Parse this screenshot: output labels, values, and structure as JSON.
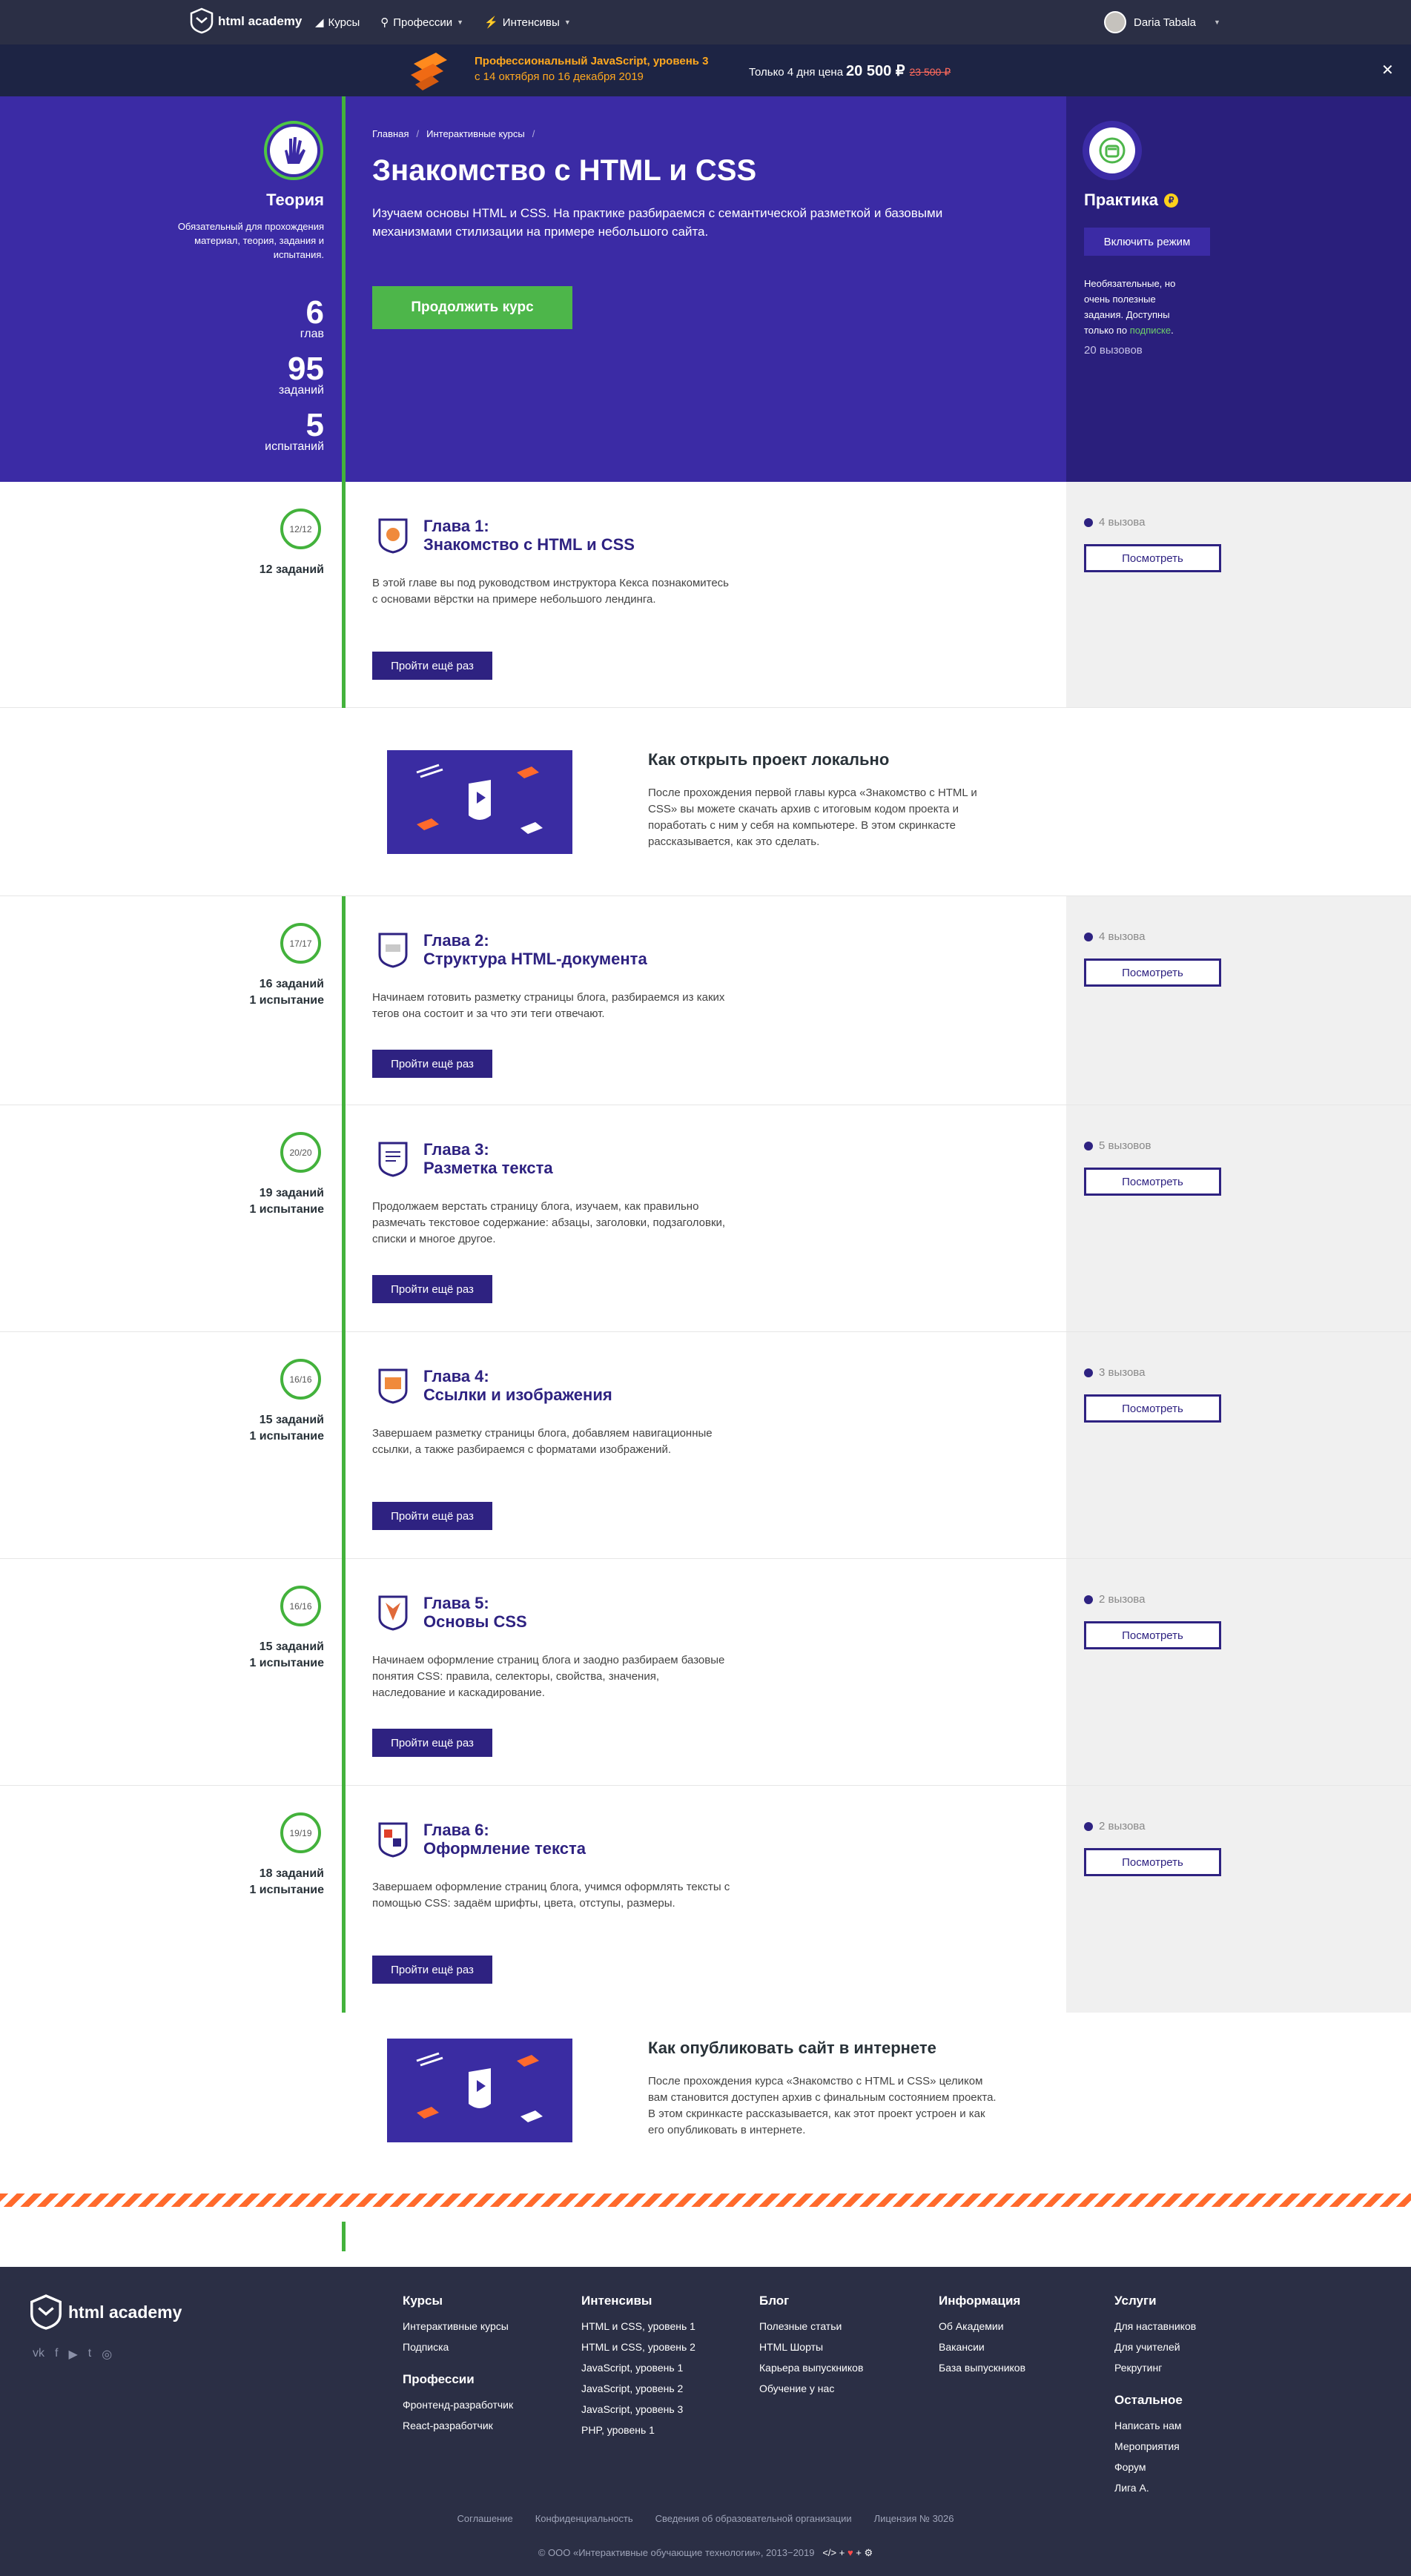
{
  "nav": {
    "logo": "html academy",
    "links": [
      "Курсы",
      "Профессии",
      "Интенсивы"
    ],
    "user": "Daria Tabala"
  },
  "banner": {
    "title": "Профессиональный JavaScript, уровень 3",
    "dates": "с 14 октября по 16 декабря 2019",
    "price_label": "Только 4 дня цена",
    "price": "20 500 ₽",
    "old_price": "23 500 ₽"
  },
  "hero": {
    "theory_title": "Теория",
    "theory_desc": "Обязательный для прохождения материал, теория, задания и испытания.",
    "stats": [
      {
        "n": "6",
        "l": "глав"
      },
      {
        "n": "95",
        "l": "заданий"
      },
      {
        "n": "5",
        "l": "испытаний"
      }
    ],
    "crumbs": [
      "Главная",
      "Интерактивные курсы"
    ],
    "title": "Знакомство с HTML и CSS",
    "lead": "Изучаем основы HTML и CSS. На практике разбираемся с семантической разметкой и базовыми механизмами стилизации на примере небольшого сайта.",
    "continue": "Продолжить курс",
    "practice_title": "Практика",
    "practice_coin": "₽",
    "practice_btn": "Включить режим",
    "practice_desc_1": "Необязательные, но очень полезные задания. Доступны только по",
    "practice_desc_link": "подписке",
    "practice_count": "20 вызовов"
  },
  "chapters": [
    {
      "badge": "12/12",
      "tasks": "12 заданий",
      "tests": "",
      "title1": "Глава 1:",
      "title2": "Знакомство с HTML и CSS",
      "desc": "В этой главе вы под руководством инструктора Кекса познакомитесь с основами вёрстки на примере небольшого лендинга.",
      "btn": "Пройти ещё раз",
      "challenges": "4 вызова",
      "view": "Посмотреть"
    },
    {
      "badge": "17/17",
      "tasks": "16 заданий",
      "tests": "1 испытание",
      "title1": "Глава 2:",
      "title2": "Структура HTML-документа",
      "desc": "Начинаем готовить разметку страницы блога, разбираемся из каких тегов она состоит и за что эти теги отвечают.",
      "btn": "Пройти ещё раз",
      "challenges": "4 вызова",
      "view": "Посмотреть"
    },
    {
      "badge": "20/20",
      "tasks": "19 заданий",
      "tests": "1 испытание",
      "title1": "Глава 3:",
      "title2": "Разметка текста",
      "desc": "Продолжаем верстать страницу блога, изучаем, как правильно размечать текстовое содержание: абзацы, заголовки, подзаголовки, списки и многое другое.",
      "btn": "Пройти ещё раз",
      "challenges": "5 вызовов",
      "view": "Посмотреть"
    },
    {
      "badge": "16/16",
      "tasks": "15 заданий",
      "tests": "1 испытание",
      "title1": "Глава 4:",
      "title2": "Ссылки и изображения",
      "desc": "Завершаем разметку страницы блога, добавляем навигационные ссылки, а также разбираемся с форматами изображений.",
      "btn": "Пройти ещё раз",
      "challenges": "3 вызова",
      "view": "Посмотреть"
    },
    {
      "badge": "16/16",
      "tasks": "15 заданий",
      "tests": "1 испытание",
      "title1": "Глава 5:",
      "title2": "Основы CSS",
      "desc": "Начинаем оформление страниц блога и заодно разбираем базовые понятия CSS: правила, селекторы, свойства, значения, наследование и каскадирование.",
      "btn": "Пройти ещё раз",
      "challenges": "2 вызова",
      "view": "Посмотреть"
    },
    {
      "badge": "19/19",
      "tasks": "18 заданий",
      "tests": "1 испытание",
      "title1": "Глава 6:",
      "title2": "Оформление текста",
      "desc": "Завершаем оформление страниц блога, учимся оформлять тексты с помощью CSS: задаём шрифты, цвета, отступы, размеры.",
      "btn": "Пройти ещё раз",
      "challenges": "2 вызова",
      "view": "Посмотреть"
    }
  ],
  "videos": [
    {
      "title": "Как открыть проект локально",
      "desc": "После прохождения первой главы курса «Знакомство с HTML и CSS» вы можете скачать архив с итоговым кодом проекта и поработать с ним у себя на компьютере. В этом скринкасте рассказывается, как это сделать."
    },
    {
      "title": "Как опубликовать сайт в интернете",
      "desc": "После прохождения курса «Знакомство с HTML и CSS» целиком вам становится доступен архив с финальным состоянием проекта. В этом скринкасте рассказывается, как этот проект устроен и как его опубликовать в интернете."
    }
  ],
  "footer": {
    "logo": "html academy",
    "cols": [
      {
        "title": "Курсы",
        "items": [
          "Интерактивные курсы",
          "Подписка"
        ],
        "sub_title": "Профессии",
        "sub_items": [
          "Фронтенд-разработчик",
          "React-разработчик"
        ]
      },
      {
        "title": "Интенсивы",
        "items": [
          "HTML и CSS, уровень 1",
          "HTML и CSS, уровень 2",
          "JavaScript, уровень 1",
          "JavaScript, уровень 2",
          "JavaScript, уровень 3",
          "PHP, уровень 1"
        ],
        "sub_title": "",
        "sub_items": []
      },
      {
        "title": "Блог",
        "items": [
          "Полезные статьи",
          "HTML Шорты",
          "Карьера выпускников",
          "Обучение у нас"
        ],
        "sub_title": "",
        "sub_items": []
      },
      {
        "title": "Информация",
        "items": [
          "Об Академии",
          "Вакансии",
          "База выпускников"
        ],
        "sub_title": "",
        "sub_items": []
      },
      {
        "title": "Услуги",
        "items": [
          "Для наставников",
          "Для учителей",
          "Рекрутинг"
        ],
        "sub_title": "Остальное",
        "sub_items": [
          "Написать нам",
          "Мероприятия",
          "Форум",
          "Лига А."
        ]
      }
    ],
    "links": [
      "Соглашение",
      "Конфиденциальность",
      "Сведения об образовательной организации",
      "Лицензия № 3026"
    ],
    "copyright": "© ООО «Интерактивные обучающие технологии», 2013−2019"
  }
}
